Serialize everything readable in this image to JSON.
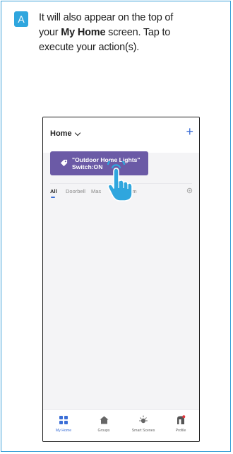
{
  "step": {
    "badge": "A"
  },
  "instruction": {
    "line1": "It will also appear on the top of",
    "line2_pre": "your ",
    "line2_bold": "My Home",
    "line2_post": " screen. Tap to",
    "line3": "execute your action(s)."
  },
  "phone": {
    "header": {
      "title": "Home",
      "add_symbol": "+"
    },
    "action_chip": {
      "line1": "\"Outdoor Home Lights\"",
      "line2": "Switch:ON"
    },
    "tabs": [
      {
        "label": "All",
        "active": true
      },
      {
        "label": "Doorbell",
        "active": false
      },
      {
        "label": "Mas",
        "active": false
      },
      {
        "label": "oom",
        "active": false
      }
    ],
    "bottom_nav": [
      {
        "label": "My Home",
        "icon": "grid-icon",
        "active": true
      },
      {
        "label": "Groups",
        "icon": "house-icon",
        "active": false
      },
      {
        "label": "Smart Scenes",
        "icon": "sun-icon",
        "active": false
      },
      {
        "label": "Profile",
        "icon": "profile-icon",
        "active": false
      }
    ]
  },
  "colors": {
    "accent_blue": "#2fa6de",
    "chip_purple": "#6b5aa6",
    "nav_active": "#3b6ed6"
  }
}
